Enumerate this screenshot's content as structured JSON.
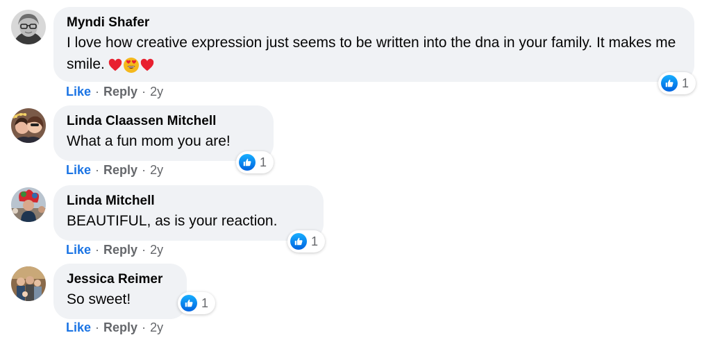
{
  "colors": {
    "bubble_bg": "#f0f2f5",
    "like_blue": "#1b74e4",
    "secondary_text": "#65676b"
  },
  "separator": "·",
  "comments": [
    {
      "author": "Myndi Shafer",
      "text": "I love how creative expression just seems to be written into the dna in your family. It makes me smile.",
      "emojis": [
        "red-heart",
        "heart-eyes-face",
        "red-heart"
      ],
      "reaction_icon": "like-icon",
      "reaction_count": "1",
      "like_label": "Like",
      "reply_label": "Reply",
      "time": "2y"
    },
    {
      "author": "Linda Claassen Mitchell",
      "text": "What a fun mom you are!",
      "reaction_icon": "like-icon",
      "reaction_count": "1",
      "like_label": "Like",
      "reply_label": "Reply",
      "time": "2y"
    },
    {
      "author": "Linda Mitchell",
      "text": "BEAUTIFUL, as is your reaction.",
      "reaction_icon": "like-icon",
      "reaction_count": "1",
      "like_label": "Like",
      "reply_label": "Reply",
      "time": "2y"
    },
    {
      "author": "Jessica Reimer",
      "text": "So sweet!",
      "reaction_icon": "like-icon",
      "reaction_count": "1",
      "like_label": "Like",
      "reply_label": "Reply",
      "time": "2y"
    }
  ]
}
